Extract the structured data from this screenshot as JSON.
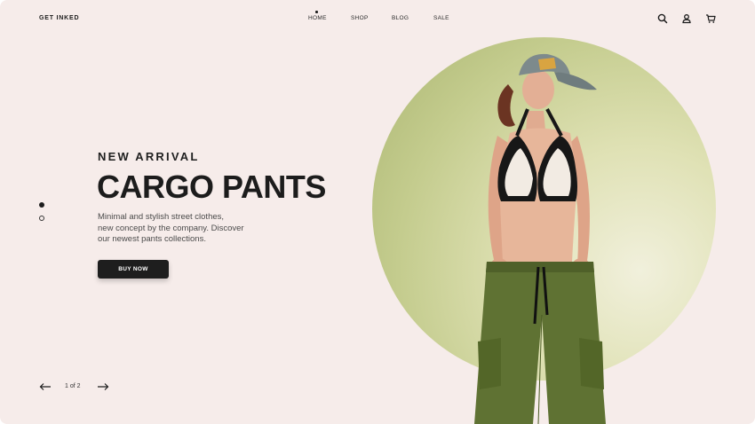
{
  "header": {
    "brand": "GET INKED",
    "nav": [
      {
        "label": "HOME",
        "active": true
      },
      {
        "label": "SHOP",
        "active": false
      },
      {
        "label": "BLOG",
        "active": false
      },
      {
        "label": "SALE",
        "active": false
      }
    ],
    "icons": [
      "search-icon",
      "user-icon",
      "cart-icon"
    ]
  },
  "hero": {
    "eyebrow": "NEW ARRIVAL",
    "title": "CARGO PANTS",
    "description_lines": [
      "Minimal and stylish street clothes,",
      "new concept by the company. Discover",
      "our newest pants collections."
    ],
    "cta_label": "BUY NOW"
  },
  "slider": {
    "total": 2,
    "current": 1,
    "page_label": "1 of 2"
  },
  "colors": {
    "background": "#f6ecea",
    "text_dark": "#1c1c1c",
    "button_bg": "#1e1e1e",
    "circle_dark": "#aab570",
    "circle_light": "#f1f0dc",
    "pants": "#5f7233",
    "cap": "#7d8a8c",
    "top": "#171717"
  }
}
